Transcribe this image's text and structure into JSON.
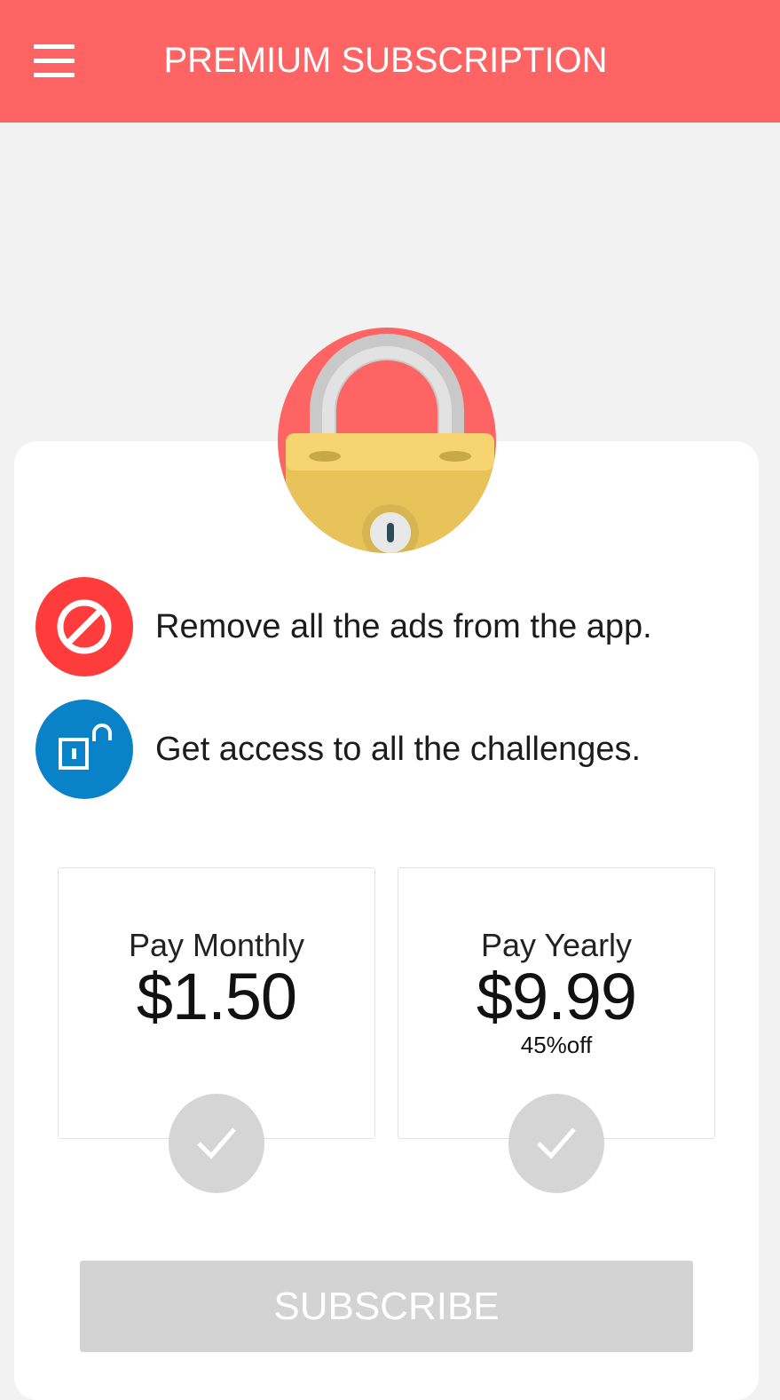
{
  "header": {
    "title": "PREMIUM SUBSCRIPTION",
    "menu_icon": "hamburger-menu-icon",
    "background_color": "#ff6464"
  },
  "hero": {
    "icon": "padlock-icon"
  },
  "features": [
    {
      "icon": "no-ads-icon",
      "icon_color": "#ff3c3c",
      "text": "Remove all the ads from the app."
    },
    {
      "icon": "unlock-icon",
      "icon_color": "#0a82c8",
      "text": "Get access to all the challenges."
    }
  ],
  "plans": [
    {
      "label": "Pay Monthly",
      "price": "$1.50",
      "discount": "",
      "selected": false
    },
    {
      "label": "Pay Yearly",
      "price": "$9.99",
      "discount": "45%off",
      "selected": false
    }
  ],
  "subscribe": {
    "label": "SUBSCRIBE",
    "enabled": false
  }
}
